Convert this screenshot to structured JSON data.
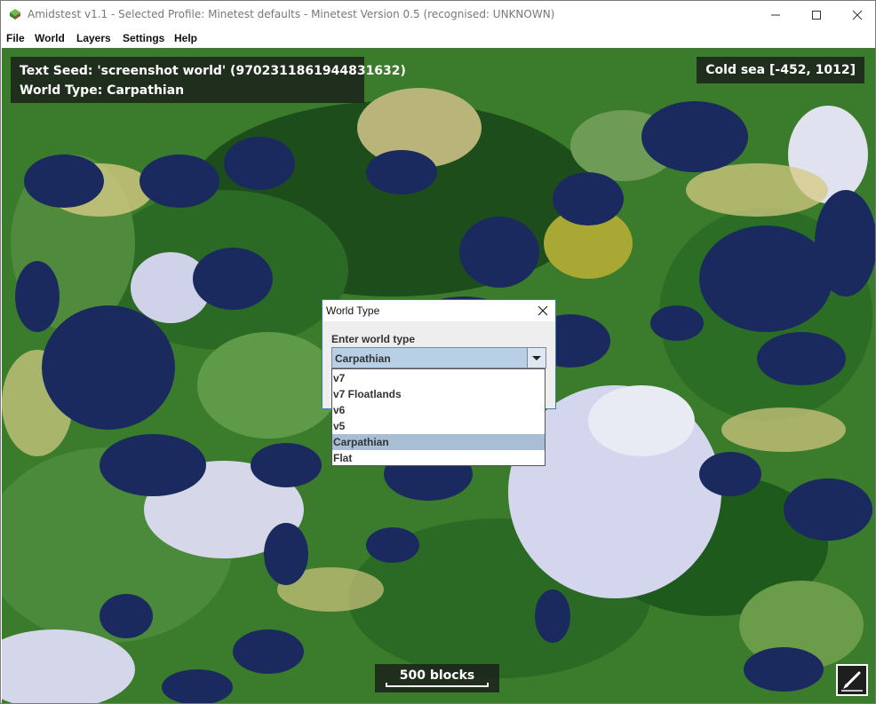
{
  "window": {
    "title": "Amidstest v1.1 - Selected Profile: Minetest defaults - Minetest Version 0.5 (recognised: UNKNOWN)"
  },
  "menu": {
    "items": [
      {
        "label": "File"
      },
      {
        "label": "World"
      },
      {
        "label": "Layers"
      },
      {
        "label": "Settings"
      },
      {
        "label": "Help"
      }
    ]
  },
  "map": {
    "seed_text": "Text Seed: 'screenshot world' (9702311861944831632)",
    "world_type_text": "World Type: Carpathian",
    "biome_info": "Cold sea [-452, 1012]",
    "scale_label": "500 blocks",
    "edit_icon": "pencil-edit-icon"
  },
  "dialog": {
    "title": "World Type",
    "prompt": "Enter world type",
    "selected_value": "Carpathian",
    "options": [
      {
        "label": "v7"
      },
      {
        "label": "v7 Floatlands"
      },
      {
        "label": "v6"
      },
      {
        "label": "v5"
      },
      {
        "label": "Carpathian"
      },
      {
        "label": "Flat"
      }
    ],
    "highlighted_index": 4
  },
  "colors": {
    "deep_ocean": "#1a2a5e",
    "forest": "#2e6b24",
    "dark_forest": "#1c4a18",
    "light_green": "#6aa84f",
    "snow": "#d8dcef",
    "beach": "#d8cc86",
    "selection": "#a7bed4"
  }
}
